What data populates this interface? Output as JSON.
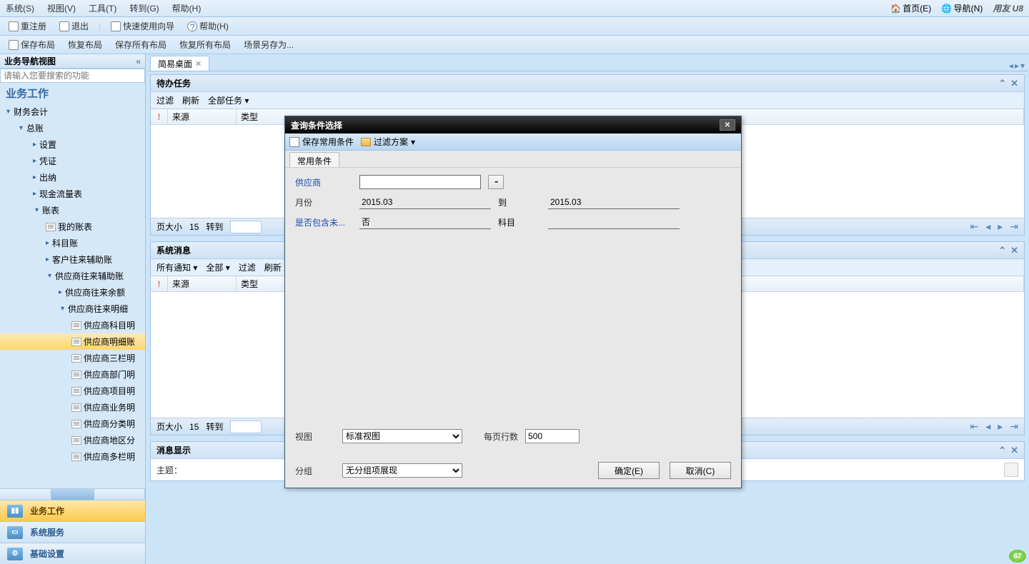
{
  "menubar": {
    "items": [
      "系统(S)",
      "视图(V)",
      "工具(T)",
      "转到(G)",
      "帮助(H)"
    ],
    "right": {
      "home": "首页(E)",
      "nav": "导航(N)",
      "logo": "用友 U8"
    }
  },
  "toolbar1": {
    "reRegister": "重注册",
    "exit": "退出",
    "wizard": "快速使用向导",
    "help": "帮助(H)"
  },
  "toolbar2": {
    "saveLayout": "保存布局",
    "restoreLayout": "恢复布局",
    "saveAll": "保存所有布局",
    "restoreAll": "恢复所有布局",
    "sceneSaveAs": "场景另存为..."
  },
  "sidebar": {
    "title": "业务导航视图",
    "searchPlaceholder": "请输入您要搜索的功能",
    "heading": "业务工作",
    "tree": {
      "n1": "财务会计",
      "n2": "总账",
      "n3": "设置",
      "n4": "凭证",
      "n5": "出纳",
      "n6": "现金流量表",
      "n7": "账表",
      "n8": "我的账表",
      "n9": "科目账",
      "n10": "客户往来辅助账",
      "n11": "供应商往来辅助账",
      "n12": "供应商往来余额",
      "n13": "供应商往来明细",
      "n14": "供应商科目明",
      "n15": "供应商明细账",
      "n16": "供应商三栏明",
      "n17": "供应商部门明",
      "n18": "供应商项目明",
      "n19": "供应商业务明",
      "n20": "供应商分类明",
      "n21": "供应商地区分",
      "n22": "供应商多栏明"
    },
    "bottom": {
      "b1": "业务工作",
      "b2": "系统服务",
      "b3": "基础设置"
    }
  },
  "content": {
    "tab": "简易桌面",
    "panel1": {
      "title": "待办任务",
      "tb": {
        "filter": "过滤",
        "refresh": "刷新",
        "all": "全部任务"
      },
      "cols": {
        "excl": "!",
        "src": "来源",
        "type": "类型"
      },
      "pager": {
        "psLabel": "页大小",
        "ps": "15",
        "gotoLabel": "转到",
        "goto": ""
      }
    },
    "panel2": {
      "title": "系统消息",
      "tb": {
        "allNotice": "所有通知",
        "all": "全部",
        "filter": "过滤",
        "refresh": "刷新"
      },
      "cols": {
        "excl": "!",
        "src": "来源",
        "type": "类型"
      },
      "pager": {
        "psLabel": "页大小",
        "ps": "15",
        "gotoLabel": "转到",
        "goto": ""
      }
    },
    "panel3": {
      "title": "消息显示",
      "subjectLabel": "主题："
    }
  },
  "dialog": {
    "title": "查询条件选择",
    "tb": {
      "saveCommon": "保存常用条件",
      "filterScheme": "过滤方案"
    },
    "tab": "常用条件",
    "form": {
      "supplierLabel": "供应商",
      "supplier": "",
      "monthLabel": "月份",
      "monthFrom": "2015.03",
      "toLabel": "到",
      "monthTo": "2015.03",
      "includeLabel": "是否包含未...",
      "includeVal": "否",
      "subjectLabel": "科目",
      "subject": ""
    },
    "footer": {
      "viewLabel": "视图",
      "viewVal": "标准视图",
      "rowsLabel": "每页行数",
      "rowsVal": "500",
      "groupLabel": "分组",
      "groupVal": "无分组项展现",
      "ok": "确定(E)",
      "cancel": "取消(C)"
    }
  },
  "badge": "67"
}
